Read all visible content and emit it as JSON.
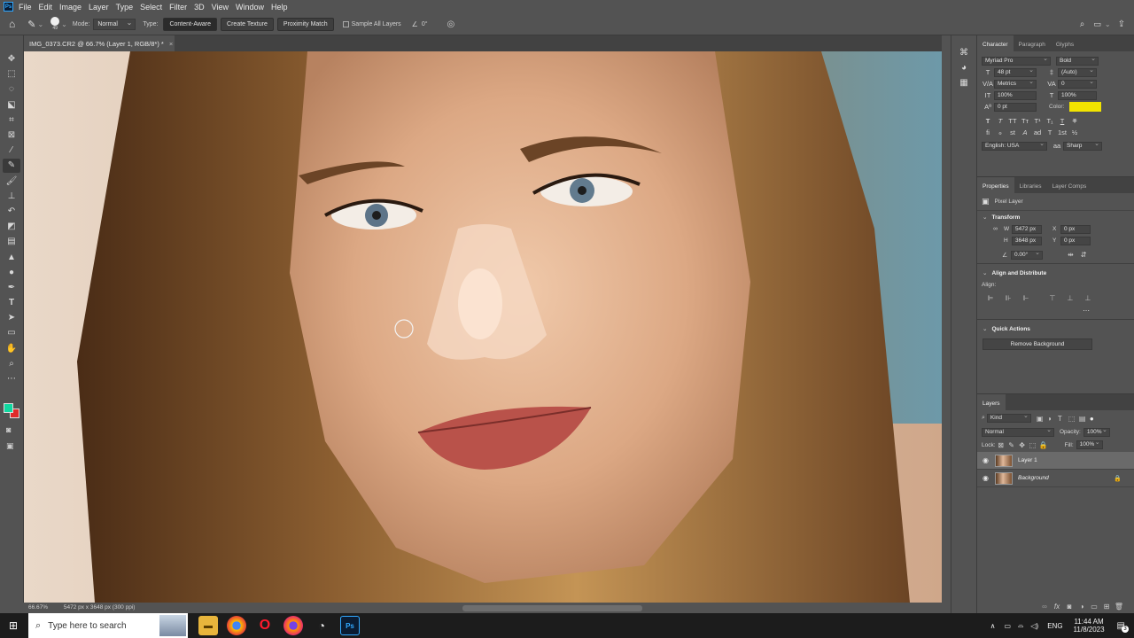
{
  "app": {
    "menu": [
      "File",
      "Edit",
      "Image",
      "Layer",
      "Type",
      "Select",
      "Filter",
      "3D",
      "View",
      "Window",
      "Help"
    ],
    "logo": "Ps"
  },
  "options_bar": {
    "brush_size": "49",
    "mode_label": "Mode:",
    "mode_value": "Normal",
    "type_label": "Type:",
    "type_buttons": [
      "Content-Aware",
      "Create Texture",
      "Proximity Match"
    ],
    "sample_all_layers": "Sample All Layers",
    "angle": "0°"
  },
  "document": {
    "tab_title": "IMG_0373.CR2 @ 66.7% (Layer 1, RGB/8*) *",
    "zoom": "66.67%",
    "dimensions": "5472 px x 3648 px (300 ppi)"
  },
  "character_panel": {
    "tabs": [
      "Character",
      "Paragraph",
      "Glyphs"
    ],
    "font_family": "Myriad Pro",
    "font_style": "Bold",
    "font_size": "48 pt",
    "leading": "(Auto)",
    "kerning": "Metrics",
    "tracking": "0",
    "vertical_scale": "100%",
    "horizontal_scale": "100%",
    "baseline_shift": "0 pt",
    "color_label": "Color:",
    "color_value": "#f2e400",
    "language": "English: USA",
    "antialias": "Sharp",
    "style_glyphs": [
      "T",
      "T",
      "TT",
      "Tт",
      "T¹",
      "T₁",
      "T",
      "T"
    ],
    "opentype_glyphs": [
      "fi",
      "ℴ",
      "st",
      "A",
      "ad",
      "T",
      "1st",
      "½"
    ]
  },
  "properties_panel": {
    "tabs": [
      "Properties",
      "Libraries",
      "Layer Comps"
    ],
    "layer_kind": "Pixel Layer",
    "transform_title": "Transform",
    "w_label": "W",
    "w_value": "5472 px",
    "h_label": "H",
    "h_value": "3648 px",
    "x_label": "X",
    "x_value": "0 px",
    "y_label": "Y",
    "y_value": "0 px",
    "angle_value": "0.00°",
    "align_title": "Align and Distribute",
    "align_label": "Align:",
    "quick_actions_title": "Quick Actions",
    "remove_background": "Remove Background"
  },
  "layers_panel": {
    "title": "Layers",
    "filter_kind": "Kind",
    "blend_mode": "Normal",
    "opacity_label": "Opacity:",
    "opacity_value": "100%",
    "lock_label": "Lock:",
    "fill_label": "Fill:",
    "fill_value": "100%",
    "layers": [
      {
        "name": "Layer 1",
        "selected": true
      },
      {
        "name": "Background",
        "selected": false
      }
    ]
  },
  "taskbar": {
    "search_placeholder": "Type here to search",
    "language": "ENG",
    "time": "11:44 AM",
    "date": "11/8/2023",
    "notifications": "3"
  },
  "colors": {
    "foreground": "#10d8a0",
    "background": "#e02a2a",
    "ui_panel": "#535353",
    "accent": "#31a8ff"
  }
}
